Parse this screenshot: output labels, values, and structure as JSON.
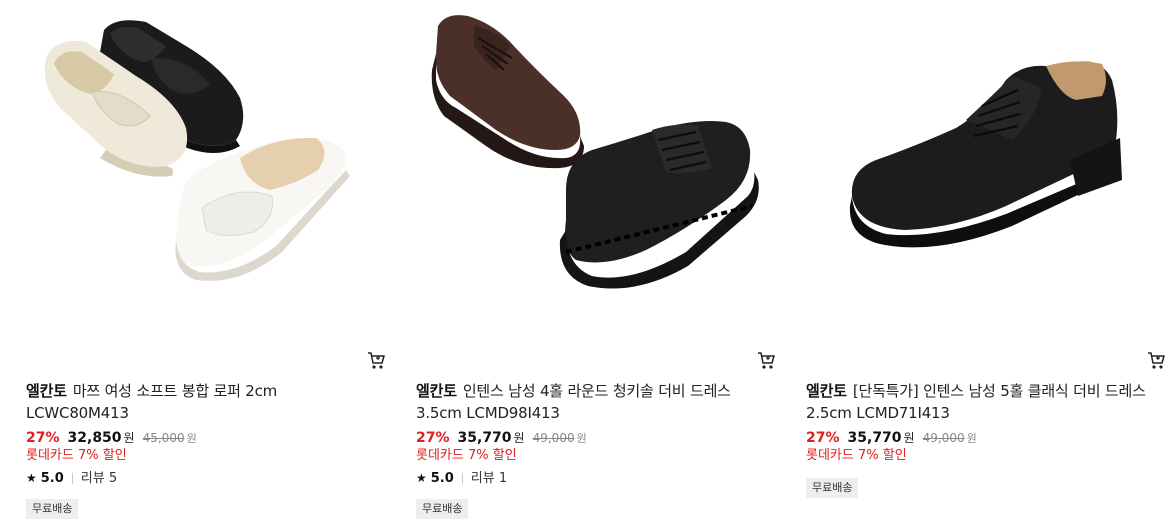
{
  "products": [
    {
      "brand": "엘칸토",
      "name_line1": "마쯔 여성 소프트 봉합 로퍼 2cm",
      "name_line2": "LCWC80M413",
      "discount": "27%",
      "sale_price": "32,850",
      "currency": "원",
      "original_price": "45,000",
      "promo": "롯데카드 7% 할인",
      "rating": "5.0",
      "reviews": "리뷰 5",
      "badge": "무료배송",
      "image_icon": "loafers-image",
      "cart_icon": "cart-icon"
    },
    {
      "brand": "엘칸토",
      "name_line1": "인텐스 남성 4홀 라운드 청키솔 더비 드레스",
      "name_line2": "3.5cm LCMD98I413",
      "discount": "27%",
      "sale_price": "35,770",
      "currency": "원",
      "original_price": "49,000",
      "promo": "롯데카드 7% 할인",
      "rating": "5.0",
      "reviews": "리뷰 1",
      "badge": "무료배송",
      "image_icon": "derby-shoes-image",
      "cart_icon": "cart-icon"
    },
    {
      "brand": "엘칸토",
      "name_line1": "[단독특가] 인텐스 남성 5홀 클래식 더비 드레스",
      "name_line2": "2.5cm LCMD71I413",
      "discount": "27%",
      "sale_price": "35,770",
      "currency": "원",
      "original_price": "49,000",
      "promo": "롯데카드 7% 할인",
      "badge": "무료배송",
      "image_icon": "classic-derby-image",
      "cart_icon": "cart-icon"
    }
  ],
  "colors": {
    "discount": "#e0201f",
    "promo": "#e0201f",
    "badge_bg": "#eeeeee"
  }
}
